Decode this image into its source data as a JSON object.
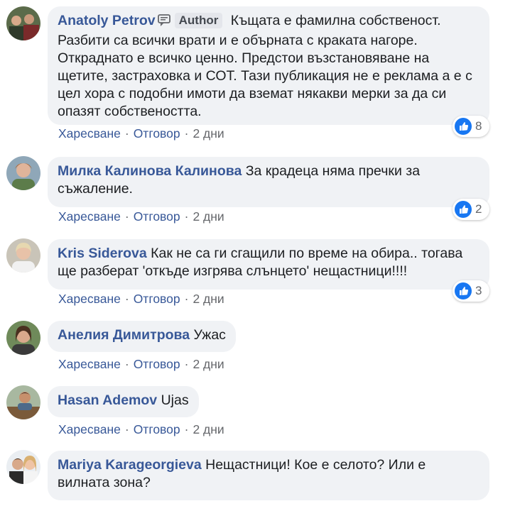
{
  "comments": [
    {
      "author": "Anatoly Petrov",
      "badge": "Author",
      "text": "Къщата е фамилна собственост. Разбити са всички врати и е обърната с краката нагоре. Откраднато е всичко ценно. Предстои възстановяване на щетите, застраховка и СОТ. Тази публикация не е реклама а е с цел хора с подобни имоти да вземат някакви мерки за да си опазят собствеността.",
      "like": "Харесване",
      "reply": "Отговор",
      "time": "2 дни",
      "reactions": "8"
    },
    {
      "author": "Милка Калинова Калинова",
      "text": "За крадеца няма пречки за съжаление.",
      "like": "Харесване",
      "reply": "Отговор",
      "time": "2 дни",
      "reactions": "2"
    },
    {
      "author": "Kris Siderova",
      "text": "Как не са ги сгащили по време на обира.. тогава ще разберат 'откъде изгрява слънцето' нещастници!!!!",
      "like": "Харесване",
      "reply": "Отговор",
      "time": "2 дни",
      "reactions": "3"
    },
    {
      "author": "Анелия Димитрова",
      "text": "Ужас",
      "like": "Харесване",
      "reply": "Отговор",
      "time": "2 дни"
    },
    {
      "author": "Hasan Ademov",
      "text": "Ujas",
      "like": "Харесване",
      "reply": "Отговор",
      "time": "2 дни"
    },
    {
      "author": "Mariya Karageorgieva",
      "text": "Нещастници! Кое е селото? Или е вилната зона?"
    }
  ],
  "separator": "·",
  "icons": {
    "reaction": "like-icon",
    "author_badge": "speech-bubble-icon"
  },
  "colors": {
    "name": "#385898",
    "bubble": "#f0f2f5",
    "like": "#1877f2",
    "meta": "#65676b"
  }
}
